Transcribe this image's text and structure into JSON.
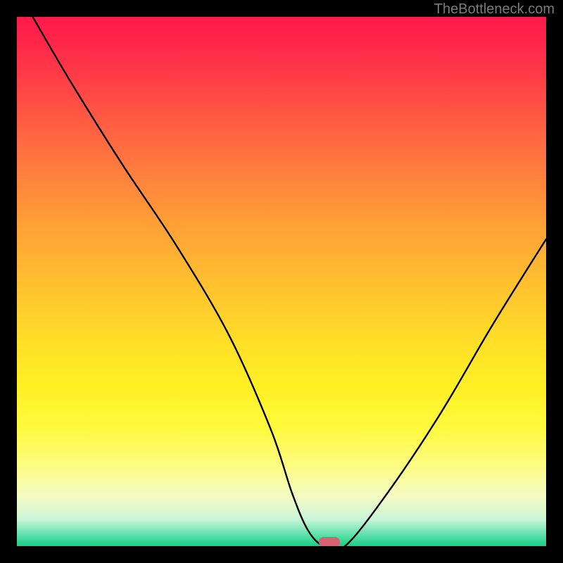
{
  "watermark": "TheBottleneck.com",
  "chart_data": {
    "type": "line",
    "title": "",
    "xlabel": "",
    "ylabel": "",
    "xlim": [
      0,
      100
    ],
    "ylim": [
      0,
      100
    ],
    "grid": false,
    "legend": false,
    "series": [
      {
        "name": "bottleneck-curve",
        "x": [
          3,
          10,
          20,
          30,
          40,
          48,
          52,
          55,
          58,
          62,
          70,
          80,
          90,
          100
        ],
        "values": [
          100,
          88,
          72,
          57,
          40,
          22,
          10,
          3,
          0,
          0,
          10,
          25,
          42,
          58
        ]
      }
    ],
    "annotations": [
      {
        "name": "optimal-marker",
        "x": 59,
        "y": 0.8,
        "shape": "pill",
        "color": "#d6636f"
      }
    ],
    "background_gradient": {
      "direction": "vertical",
      "stops": [
        {
          "pos": 0,
          "color": "#ff1a4a"
        },
        {
          "pos": 50,
          "color": "#ffd22c"
        },
        {
          "pos": 80,
          "color": "#fffa60"
        },
        {
          "pos": 100,
          "color": "#18cf86"
        }
      ]
    }
  },
  "marker": {
    "color": "#d6636f"
  }
}
